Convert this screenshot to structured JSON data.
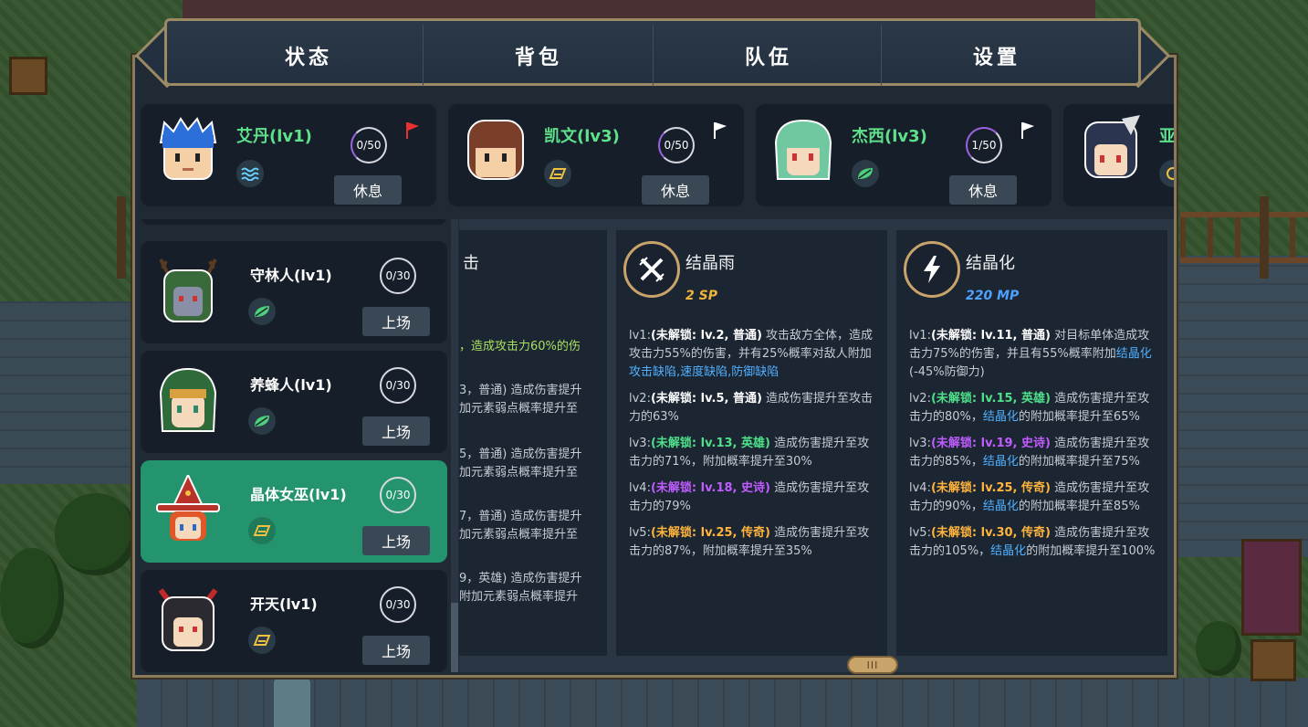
{
  "tabs": [
    {
      "label": "状态"
    },
    {
      "label": "背包"
    },
    {
      "label": "队伍"
    },
    {
      "label": "设置"
    }
  ],
  "team": [
    {
      "name": "艾丹(lv1)",
      "exp": "0/50",
      "exp_fraction": 0.0,
      "element_icon": "water-wave-icon",
      "action": "休息",
      "flag_color": "#e83030"
    },
    {
      "name": "凯文(lv3)",
      "exp": "0/50",
      "exp_fraction": 0.0,
      "element_icon": "crystal-icon",
      "action": "休息",
      "flag_color": "#ffffff"
    },
    {
      "name": "杰西(lv3)",
      "exp": "1/50",
      "exp_fraction": 0.02,
      "element_icon": "leaf-icon",
      "action": "休息",
      "flag_color": "#ffffff"
    },
    {
      "name": "亚",
      "element_icon": "wind-icon"
    }
  ],
  "reserve": [
    {
      "name": "守林人(lv1)",
      "exp": "0/30",
      "element_icon": "leaf-icon",
      "action": "上场",
      "active": false
    },
    {
      "name": "养蜂人(lv1)",
      "exp": "0/30",
      "element_icon": "leaf-icon",
      "action": "上场",
      "active": false
    },
    {
      "name": "晶体女巫(lv1)",
      "exp": "0/30",
      "element_icon": "crystal-icon",
      "action": "上场",
      "active": true
    },
    {
      "name": "开天(lv1)",
      "exp": "0/30",
      "element_icon": "crystal-icon",
      "action": "上场",
      "active": false
    }
  ],
  "partial_card": {
    "title": "击",
    "fragments": [
      "，造成攻击力60%的伤",
      "3，普通) 造成伤害提升",
      "加元素弱点概率提升至",
      "5，普通) 造成伤害提升",
      "加元素弱点概率提升至",
      "7，普通) 造成伤害提升",
      "加元素弱点概率提升至",
      "9，英雄) 造成伤害提升",
      "附加元素弱点概率提升"
    ]
  },
  "skill_cards": [
    {
      "title": "结晶雨",
      "cost": "2 SP",
      "cost_color": "#f0b43c",
      "icon": "crossed-swords-icon",
      "levels": [
        {
          "lv": "lv1:",
          "tag": "(未解锁: lv.2, 普通)",
          "tag_class": "c-white",
          "text": " 攻击敌方全体，造成攻击力55%的伤害，并有25%概率对敌人附加",
          "link": "攻击缺陷,速度缺陷,防御缺陷",
          "tail": ""
        },
        {
          "lv": "lv2:",
          "tag": "(未解锁: lv.5, 普通)",
          "tag_class": "c-white",
          "text": " 造成伤害提升至攻击力的63%",
          "link": "",
          "tail": ""
        },
        {
          "lv": "lv3:",
          "tag": "(未解锁: lv.13, 英雄)",
          "tag_class": "c-green",
          "text": " 造成伤害提升至攻击力的71%，附加概率提升至30%",
          "link": "",
          "tail": ""
        },
        {
          "lv": "lv4:",
          "tag": "(未解锁: lv.18, 史诗)",
          "tag_class": "c-purple",
          "text": " 造成伤害提升至攻击力的79%",
          "link": "",
          "tail": ""
        },
        {
          "lv": "lv5:",
          "tag": "(未解锁: lv.25, 传奇)",
          "tag_class": "c-gold",
          "text": " 造成伤害提升至攻击力的87%，附加概率提升至35%",
          "link": "",
          "tail": ""
        }
      ]
    },
    {
      "title": "结晶化",
      "cost": "220 MP",
      "cost_color": "#4fa0ff",
      "icon": "lightning-icon",
      "levels": [
        {
          "lv": "lv1:",
          "tag": "(未解锁: lv.11, 普通)",
          "tag_class": "c-white",
          "text": " 对目标单体造成攻击力75%的伤害，并且有55%概率附加",
          "link": "结晶化",
          "tail": "(-45%防御力)"
        },
        {
          "lv": "lv2:",
          "tag": "(未解锁: lv.15, 英雄)",
          "tag_class": "c-green",
          "text": " 造成伤害提升至攻击力的80%，",
          "link": "结晶化",
          "tail": "的附加概率提升至65%"
        },
        {
          "lv": "lv3:",
          "tag": "(未解锁: lv.19, 史诗)",
          "tag_class": "c-purple",
          "text": " 造成伤害提升至攻击力的85%，",
          "link": "结晶化",
          "tail": "的附加概率提升至75%"
        },
        {
          "lv": "lv4:",
          "tag": "(未解锁: lv.25, 传奇)",
          "tag_class": "c-gold",
          "text": " 造成伤害提升至攻击力的90%，",
          "link": "结晶化",
          "tail": "的附加概率提升至85%"
        },
        {
          "lv": "lv5:",
          "tag": "(未解锁: lv.30, 传奇)",
          "tag_class": "c-gold",
          "text": " 造成伤害提升至攻击力的105%，",
          "link": "结晶化",
          "tail": "的附加概率提升至100%"
        }
      ]
    }
  ],
  "colors": {
    "accent_green": "#5fe08a",
    "active_row": "#23946d",
    "frame_gold": "#9c8a64"
  }
}
